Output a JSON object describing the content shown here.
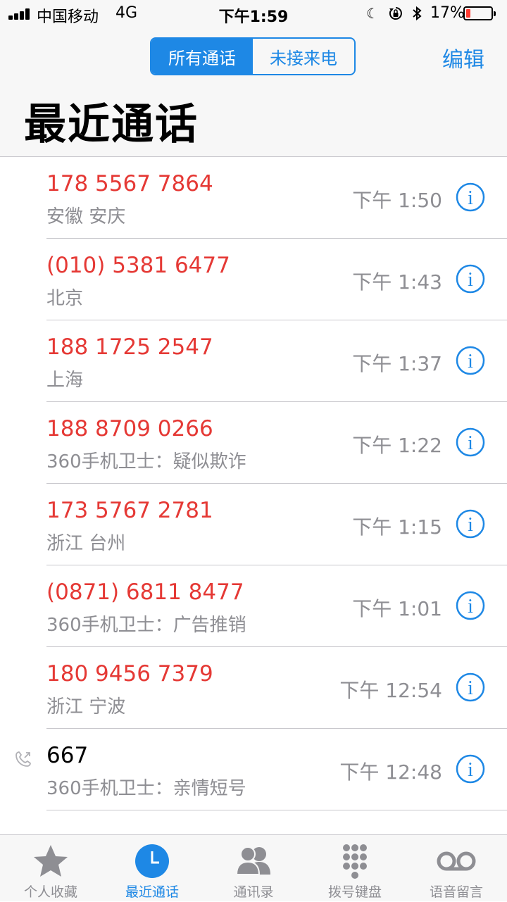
{
  "status_bar": {
    "carrier": "中国移动",
    "network": "4G",
    "time": "下午1:59",
    "battery_percent": "17%",
    "battery_level": 0.17,
    "icons": [
      "signal-icon",
      "moon-icon",
      "rotation-lock-icon",
      "bluetooth-icon",
      "battery-icon"
    ]
  },
  "header": {
    "segments": [
      "所有通话",
      "未接来电"
    ],
    "edit_label": "编辑",
    "title": "最近通话"
  },
  "colors": {
    "accent": "#1e88e5",
    "missed": "#e53935",
    "secondary": "#8e8e93"
  },
  "calls": [
    {
      "number": "178 5567 7864",
      "label": "安徽 安庆",
      "time": "下午 1:50",
      "missed": true
    },
    {
      "number": "(010) 5381 6477",
      "label": "北京",
      "time": "下午 1:43",
      "missed": true
    },
    {
      "number": "188 1725 2547",
      "label": "上海",
      "time": "下午 1:37",
      "missed": true
    },
    {
      "number": "188 8709 0266",
      "label": "360手机卫士：疑似欺诈",
      "time": "下午 1:22",
      "missed": true
    },
    {
      "number": "173 5767 2781",
      "label": "浙江 台州",
      "time": "下午 1:15",
      "missed": true
    },
    {
      "number": "(0871) 6811 8477",
      "label": "360手机卫士：广告推销",
      "time": "下午 1:01",
      "missed": true
    },
    {
      "number": "180 9456 7379",
      "label": "浙江 宁波",
      "time": "下午 12:54",
      "missed": true
    },
    {
      "number": "667",
      "label": "360手机卫士：亲情短号",
      "time": "下午 12:48",
      "missed": false
    }
  ],
  "tabs": [
    {
      "label": "个人收藏",
      "icon": "star-icon"
    },
    {
      "label": "最近通话",
      "icon": "clock-icon",
      "active": true
    },
    {
      "label": "通讯录",
      "icon": "contacts-icon"
    },
    {
      "label": "拨号键盘",
      "icon": "keypad-icon"
    },
    {
      "label": "语音留言",
      "icon": "voicemail-icon"
    }
  ]
}
